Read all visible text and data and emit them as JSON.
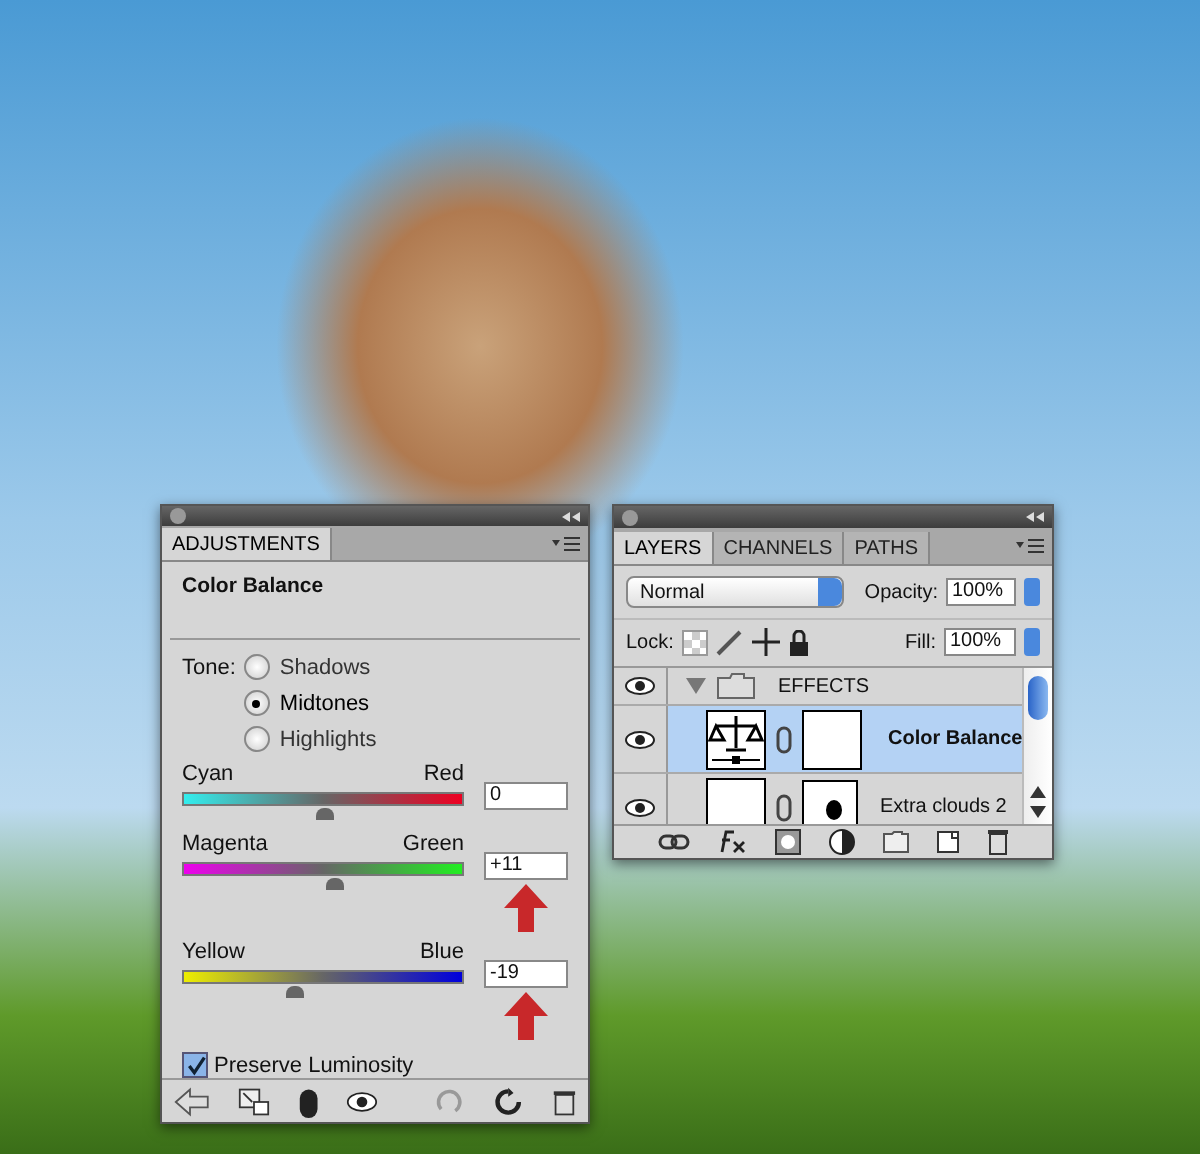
{
  "adjustments": {
    "tab": "ADJUSTMENTS",
    "title": "Color Balance",
    "tone_label": "Tone:",
    "tones": [
      {
        "label": "Shadows",
        "selected": false
      },
      {
        "label": "Midtones",
        "selected": true
      },
      {
        "label": "Highlights",
        "selected": false
      }
    ],
    "sliders": [
      {
        "left": "Cyan",
        "right": "Red",
        "level": 0.5,
        "value": "0"
      },
      {
        "left": "Magenta",
        "right": "Green",
        "level": 0.54,
        "value": "+11"
      },
      {
        "left": "Yellow",
        "right": "Blue",
        "level": 0.4,
        "value": "-19"
      }
    ],
    "preserve": {
      "label": "Preserve Luminosity",
      "checked": true
    }
  },
  "layers_panel": {
    "tabs": [
      {
        "label": "LAYERS",
        "selected": true
      },
      {
        "label": "CHANNELS",
        "selected": false
      },
      {
        "label": "PATHS",
        "selected": false
      }
    ],
    "blend_mode": "Normal",
    "opacity_label": "Opacity:",
    "opacity": "100%",
    "lock_label": "Lock:",
    "fill_label": "Fill:",
    "fill": "100%",
    "layers": [
      {
        "name": "EFFECTS",
        "kind": "group",
        "visible": true,
        "selected": false,
        "expanded": true,
        "children": [
          {
            "name": "Color Balance",
            "kind": "adjustment",
            "visible": true,
            "selected": true
          },
          {
            "name": "Extra clouds 2",
            "kind": "pixel",
            "visible": true,
            "selected": false
          }
        ]
      }
    ]
  }
}
